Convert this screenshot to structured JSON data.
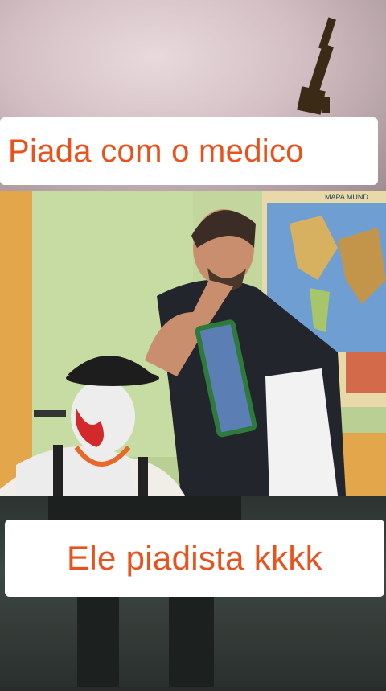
{
  "captions": {
    "top": "Piada com o medico",
    "bottom": "Ele piadista kkkk"
  },
  "map_title": "MAPA MUND",
  "colors": {
    "caption_text": "#e9521c",
    "caption_bg": "#ffffff",
    "wall": "#b9cf93"
  }
}
